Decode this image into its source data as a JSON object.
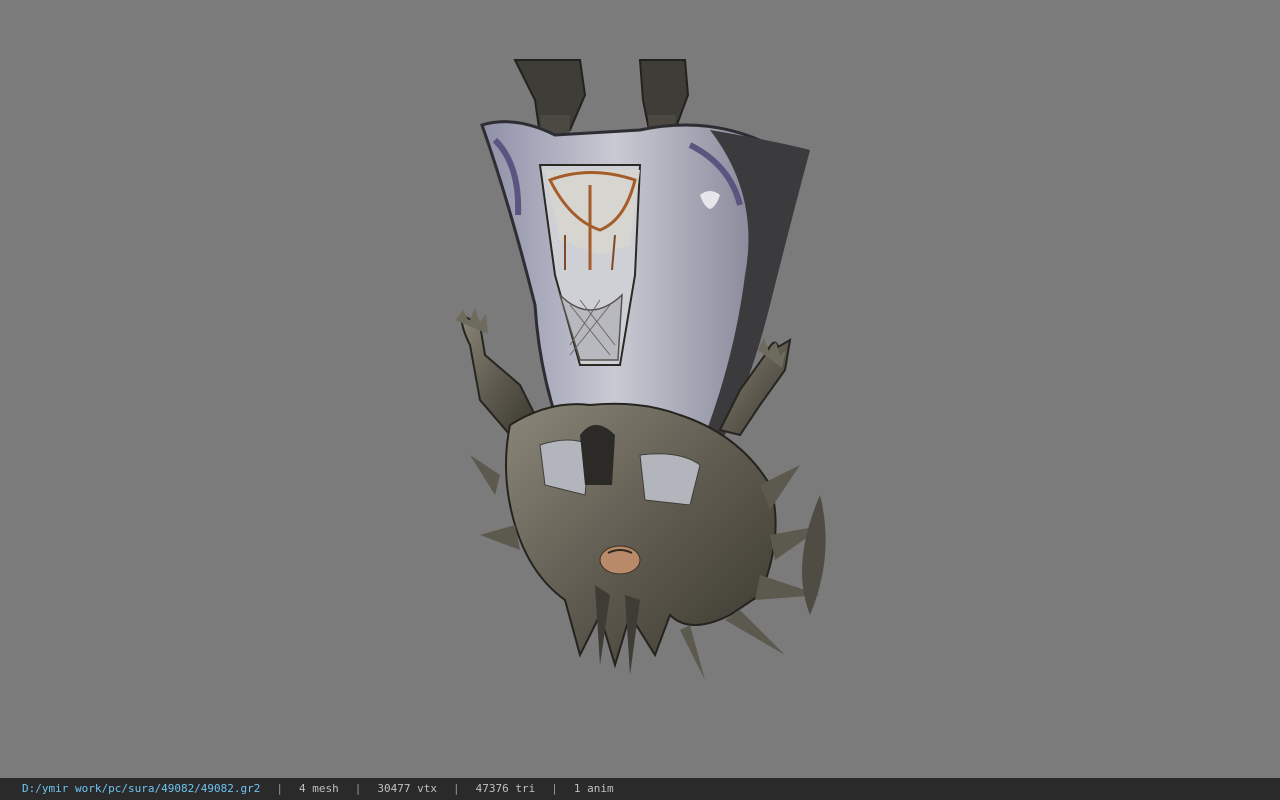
{
  "viewer": {
    "background_color": "#7b7b7b",
    "model": {
      "icon": "upside-down-armored-character-model",
      "armor_color": "#6f6b60",
      "cloth_color": "#b9bccb",
      "cloth_accent": "#5a5480"
    }
  },
  "status": {
    "file_path": "D:/ymir work/pc/sura/49082/49082.gr2",
    "separator": "|",
    "mesh": "4 mesh",
    "vertices": "30477 vtx",
    "triangles": "47376 tri",
    "animations": "1 anim",
    "path_color": "#6ec3f2",
    "bar_color": "#2a2a2a"
  }
}
